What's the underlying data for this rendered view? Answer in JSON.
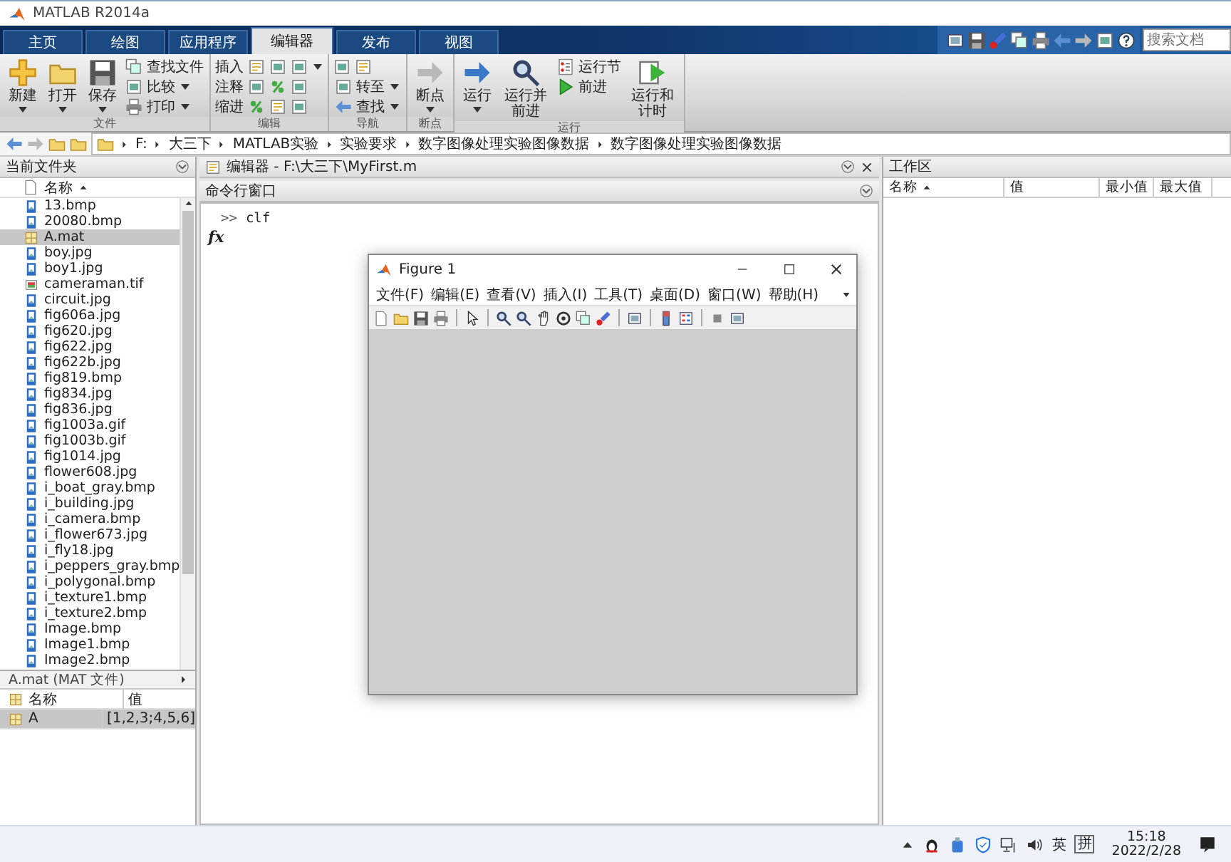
{
  "window": {
    "title": "MATLAB R2014a"
  },
  "tabs": [
    {
      "label": "主页",
      "selected": false
    },
    {
      "label": "绘图",
      "selected": false
    },
    {
      "label": "应用程序",
      "selected": false
    },
    {
      "label": "编辑器",
      "selected": true
    },
    {
      "label": "发布",
      "selected": false
    },
    {
      "label": "视图",
      "selected": false
    }
  ],
  "search": {
    "placeholder": "搜索文档"
  },
  "ribbon": [
    {
      "label": "文件",
      "columns": [
        {
          "kind": "large",
          "label": "新建",
          "menu": true
        },
        {
          "kind": "large",
          "label": "打开",
          "menu": true
        },
        {
          "kind": "large",
          "label": "保存",
          "menu": true
        },
        {
          "kind": "stack",
          "rows": [
            {
              "kind": "button",
              "label": "查找文件",
              "menu": false
            },
            {
              "kind": "button",
              "label": "比较",
              "menu": true
            },
            {
              "kind": "button",
              "label": "打印",
              "menu": true
            }
          ]
        }
      ]
    },
    {
      "label": "编辑",
      "columns": [
        {
          "kind": "stack",
          "rows": [
            {
              "kind": "iconrow",
              "label": "插入",
              "menu": true
            },
            {
              "kind": "iconrow",
              "label": "注释",
              "menu": false
            },
            {
              "kind": "iconrow",
              "label": "缩进",
              "menu": false
            }
          ]
        }
      ]
    },
    {
      "label": "导航",
      "columns": [
        {
          "kind": "stack",
          "rows": [
            {
              "kind": "icons",
              "menu": false
            },
            {
              "kind": "button",
              "label": "转至",
              "menu": true
            },
            {
              "kind": "button",
              "label": "查找",
              "menu": true
            }
          ]
        }
      ]
    },
    {
      "label": "断点",
      "columns": [
        {
          "kind": "large",
          "label": "断点",
          "menu": true
        }
      ]
    },
    {
      "label": "运行",
      "columns": [
        {
          "kind": "large",
          "label": "运行",
          "menu": true
        },
        {
          "kind": "large",
          "label": "运行并前进",
          "menu": false
        },
        {
          "kind": "stack",
          "rows": [
            {
              "kind": "button",
              "label": "运行节",
              "menu": false
            },
            {
              "kind": "button",
              "label": "前进",
              "menu": false
            }
          ]
        },
        {
          "kind": "large",
          "label": "运行和计时",
          "menu": false
        }
      ]
    }
  ],
  "address": {
    "segments": [
      "F:",
      "大三下",
      "MATLAB实验",
      "实验要求",
      "数字图像处理实验图像数据",
      "数字图像处理实验图像数据"
    ]
  },
  "current_folder": {
    "title": "当前文件夹",
    "column": {
      "label": "名称",
      "sorted": true
    },
    "files": [
      {
        "name": "13.bmp",
        "kind": "image",
        "selected": false
      },
      {
        "name": "20080.bmp",
        "kind": "image",
        "selected": false
      },
      {
        "name": "A.mat",
        "kind": "mat",
        "selected": true
      },
      {
        "name": "boy.jpg",
        "kind": "image",
        "selected": false
      },
      {
        "name": "boy1.jpg",
        "kind": "image",
        "selected": false
      },
      {
        "name": "cameraman.tif",
        "kind": "tiff",
        "selected": false
      },
      {
        "name": "circuit.jpg",
        "kind": "image",
        "selected": false
      },
      {
        "name": "fig606a.jpg",
        "kind": "image",
        "selected": false
      },
      {
        "name": "fig620.jpg",
        "kind": "image",
        "selected": false
      },
      {
        "name": "fig622.jpg",
        "kind": "image",
        "selected": false
      },
      {
        "name": "fig622b.jpg",
        "kind": "image",
        "selected": false
      },
      {
        "name": "fig819.bmp",
        "kind": "image",
        "selected": false
      },
      {
        "name": "fig834.jpg",
        "kind": "image",
        "selected": false
      },
      {
        "name": "fig836.jpg",
        "kind": "image",
        "selected": false
      },
      {
        "name": "fig1003a.gif",
        "kind": "image",
        "selected": false
      },
      {
        "name": "fig1003b.gif",
        "kind": "image",
        "selected": false
      },
      {
        "name": "fig1014.jpg",
        "kind": "image",
        "selected": false
      },
      {
        "name": "flower608.jpg",
        "kind": "image",
        "selected": false
      },
      {
        "name": "i_boat_gray.bmp",
        "kind": "image",
        "selected": false
      },
      {
        "name": "i_building.jpg",
        "kind": "image",
        "selected": false
      },
      {
        "name": "i_camera.bmp",
        "kind": "image",
        "selected": false
      },
      {
        "name": "i_flower673.jpg",
        "kind": "image",
        "selected": false
      },
      {
        "name": "i_fly18.jpg",
        "kind": "image",
        "selected": false
      },
      {
        "name": "i_peppers_gray.bmp",
        "kind": "image",
        "selected": false
      },
      {
        "name": "i_polygonal.bmp",
        "kind": "image",
        "selected": false
      },
      {
        "name": "i_texture1.bmp",
        "kind": "image",
        "selected": false
      },
      {
        "name": "i_texture2.bmp",
        "kind": "image",
        "selected": false
      },
      {
        "name": "Image.bmp",
        "kind": "image",
        "selected": false
      },
      {
        "name": "Image1.bmp",
        "kind": "image",
        "selected": false
      },
      {
        "name": "Image2.bmp",
        "kind": "image",
        "selected": false
      }
    ],
    "details": {
      "title": "A.mat (MAT 文件)",
      "columns": [
        "名称",
        "值"
      ],
      "rows": [
        {
          "name": "A",
          "value": "[1,2,3;4,5,6]",
          "selected": true
        }
      ]
    }
  },
  "editor": {
    "title": "编辑器 - F:\\大三下\\MyFirst.m"
  },
  "command_window": {
    "title": "命令行窗口",
    "lines": [
      {
        "prompt": ">>",
        "text": "clf"
      }
    ],
    "function_hint": "fx"
  },
  "workspace": {
    "title": "工作区",
    "columns": [
      {
        "label": "名称",
        "sorted": true
      },
      {
        "label": "值",
        "sorted": false
      },
      {
        "label": "最小值",
        "sorted": false
      },
      {
        "label": "最大值",
        "sorted": false
      }
    ]
  },
  "figure": {
    "title": "Figure 1",
    "menus": [
      "文件(F)",
      "编辑(E)",
      "查看(V)",
      "插入(I)",
      "工具(T)",
      "桌面(D)",
      "窗口(W)",
      "帮助(H)"
    ]
  },
  "taskbar": {
    "language": "英",
    "ime": "拼",
    "time": "15:18",
    "date": "2022/2/28"
  }
}
